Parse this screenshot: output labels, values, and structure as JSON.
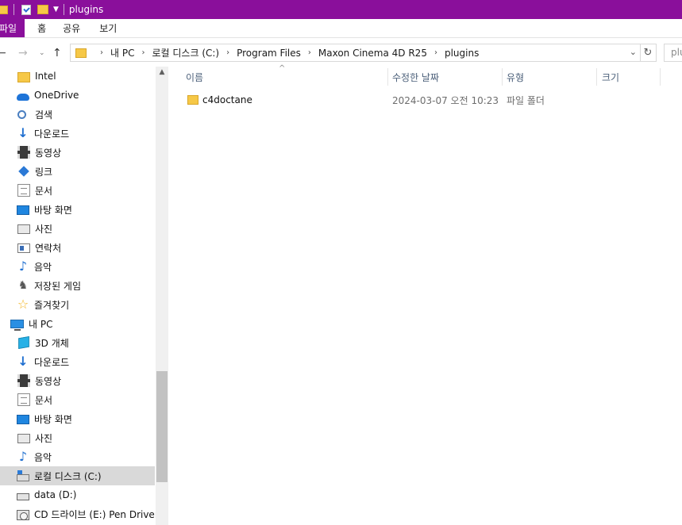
{
  "window": {
    "title": "plugins"
  },
  "ribbon": {
    "tabs": [
      "파일",
      "홈",
      "공유",
      "보기"
    ]
  },
  "address": {
    "breadcrumb": [
      "내 PC",
      "로컬 디스크 (C:)",
      "Program Files",
      "Maxon Cinema 4D R25",
      "plugins"
    ],
    "search_placeholder": "plugins 검색"
  },
  "sidebar": {
    "items": [
      {
        "label": "Intel",
        "icon": "folder-icon"
      },
      {
        "label": "OneDrive",
        "icon": "cloud-icon"
      },
      {
        "label": "검색",
        "icon": "search-icon"
      },
      {
        "label": "다운로드",
        "icon": "download-icon"
      },
      {
        "label": "동영상",
        "icon": "video-icon"
      },
      {
        "label": "링크",
        "icon": "link-icon"
      },
      {
        "label": "문서",
        "icon": "document-icon"
      },
      {
        "label": "바탕 화면",
        "icon": "desktop-icon"
      },
      {
        "label": "사진",
        "icon": "picture-icon"
      },
      {
        "label": "연락처",
        "icon": "contacts-icon"
      },
      {
        "label": "음악",
        "icon": "music-icon"
      },
      {
        "label": "저장된 게임",
        "icon": "saved-games-icon"
      },
      {
        "label": "즐겨찾기",
        "icon": "favorites-icon"
      },
      {
        "label": "내 PC",
        "icon": "pc-icon"
      },
      {
        "label": "3D 개체",
        "icon": "3d-objects-icon"
      },
      {
        "label": "다운로드",
        "icon": "download-icon"
      },
      {
        "label": "동영상",
        "icon": "video-icon"
      },
      {
        "label": "문서",
        "icon": "document-icon"
      },
      {
        "label": "바탕 화면",
        "icon": "desktop-icon"
      },
      {
        "label": "사진",
        "icon": "picture-icon"
      },
      {
        "label": "음악",
        "icon": "music-icon"
      },
      {
        "label": "로컬 디스크 (C:)",
        "icon": "local-disk-icon"
      },
      {
        "label": "data (D:)",
        "icon": "drive-icon"
      },
      {
        "label": "CD 드라이브 (E:) Pen Driver",
        "icon": "cd-drive-icon"
      }
    ],
    "selected": "로컬 디스크 (C:)"
  },
  "file_list": {
    "columns": [
      "이름",
      "수정한 날짜",
      "유형",
      "크기"
    ],
    "rows": [
      {
        "name": "c4doctane",
        "modified": "2024-03-07 오전 10:23",
        "type": "파일 폴더",
        "size": ""
      }
    ]
  }
}
